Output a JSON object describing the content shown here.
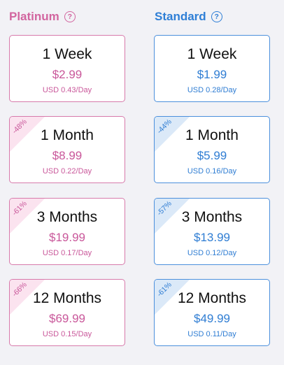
{
  "platinum": {
    "title": "Platinum",
    "help_glyph": "?",
    "color": "#d2659f",
    "plans": [
      {
        "duration": "1 Week",
        "price": "$2.99",
        "per_day": "USD 0.43/Day",
        "discount": ""
      },
      {
        "duration": "1 Month",
        "price": "$8.99",
        "per_day": "USD 0.22/Day",
        "discount": "-48%"
      },
      {
        "duration": "3 Months",
        "price": "$19.99",
        "per_day": "USD 0.17/Day",
        "discount": "-61%"
      },
      {
        "duration": "12 Months",
        "price": "$69.99",
        "per_day": "USD 0.15/Day",
        "discount": "-66%"
      }
    ]
  },
  "standard": {
    "title": "Standard",
    "help_glyph": "?",
    "color": "#2f7fd6",
    "plans": [
      {
        "duration": "1 Week",
        "price": "$1.99",
        "per_day": "USD 0.28/Day",
        "discount": ""
      },
      {
        "duration": "1 Month",
        "price": "$5.99",
        "per_day": "USD 0.16/Day",
        "discount": "-44%"
      },
      {
        "duration": "3 Months",
        "price": "$13.99",
        "per_day": "USD 0.12/Day",
        "discount": "-57%"
      },
      {
        "duration": "12 Months",
        "price": "$49.99",
        "per_day": "USD 0.11/Day",
        "discount": "-61%"
      }
    ]
  }
}
